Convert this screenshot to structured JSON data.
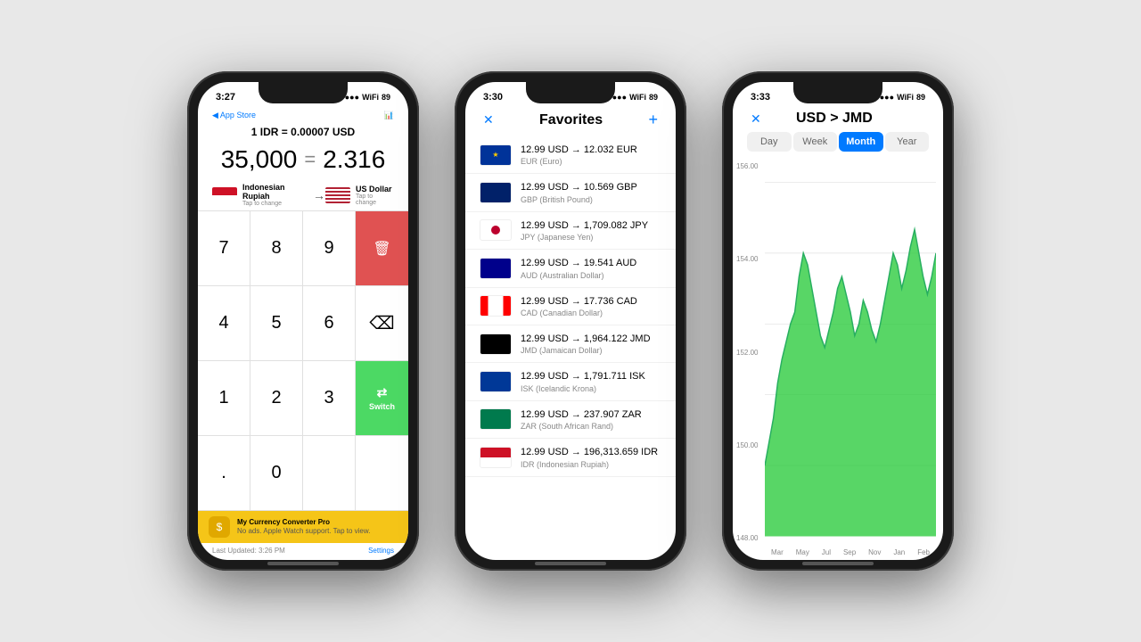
{
  "phone1": {
    "status_time": "3:27",
    "nav_back": "◀ App Store",
    "title": "1 IDR = 0.00007 USD",
    "amount_from": "35,000",
    "amount_eq": "=",
    "amount_to": "2.316",
    "currency_from": "Indonesian Rupiah",
    "currency_from_tap": "Tap to change",
    "currency_to": "US Dollar",
    "currency_to_tap": "Tap to change",
    "keys": [
      "7",
      "8",
      "9",
      "🗑",
      "4",
      "5",
      "6",
      "⌫",
      "1",
      "2",
      "3",
      "Switch",
      ".",
      "0",
      "",
      ""
    ],
    "banner_title": "My Currency Converter Pro",
    "banner_sub": "No ads. Apple Watch support. Tap to view.",
    "footer_updated": "Last Updated: 3:26 PM",
    "footer_settings": "Settings"
  },
  "phone2": {
    "status_time": "3:30",
    "title": "Favorites",
    "items": [
      {
        "from": "12.99 USD",
        "arrow": "→",
        "to": "12.032 EUR",
        "sub": "EUR (Euro)",
        "flag": "eu"
      },
      {
        "from": "12.99 USD",
        "arrow": "→",
        "to": "10.569 GBP",
        "sub": "GBP (British Pound)",
        "flag": "gb"
      },
      {
        "from": "12.99 USD",
        "arrow": "→",
        "to": "1,709.082 JPY",
        "sub": "JPY (Japanese Yen)",
        "flag": "jp"
      },
      {
        "from": "12.99 USD",
        "arrow": "→",
        "to": "19.541 AUD",
        "sub": "AUD (Australian Dollar)",
        "flag": "au"
      },
      {
        "from": "12.99 USD",
        "arrow": "→",
        "to": "17.736 CAD",
        "sub": "CAD (Canadian Dollar)",
        "flag": "ca"
      },
      {
        "from": "12.99 USD",
        "arrow": "→",
        "to": "1,964.122 JMD",
        "sub": "JMD (Jamaican Dollar)",
        "flag": "jm"
      },
      {
        "from": "12.99 USD",
        "arrow": "→",
        "to": "1,791.711 ISK",
        "sub": "ISK (Icelandic Krona)",
        "flag": "is"
      },
      {
        "from": "12.99 USD",
        "arrow": "→",
        "to": "237.907 ZAR",
        "sub": "ZAR (South African Rand)",
        "flag": "za"
      },
      {
        "from": "12.99 USD",
        "arrow": "→",
        "to": "196,313.659 IDR",
        "sub": "IDR (Indonesian Rupiah)",
        "flag": "id"
      }
    ]
  },
  "phone3": {
    "status_time": "3:33",
    "title": "USD > JMD",
    "time_tabs": [
      "Day",
      "Week",
      "Month",
      "Year"
    ],
    "active_tab": 2,
    "y_labels": [
      "156.00",
      "154.00",
      "152.00",
      "150.00",
      "148.00"
    ],
    "x_labels": [
      "Mar",
      "May",
      "Jul",
      "Sep",
      "Nov",
      "Jan",
      "Feb"
    ]
  },
  "battery": "89",
  "wifi": "▲",
  "signal": "●●●"
}
